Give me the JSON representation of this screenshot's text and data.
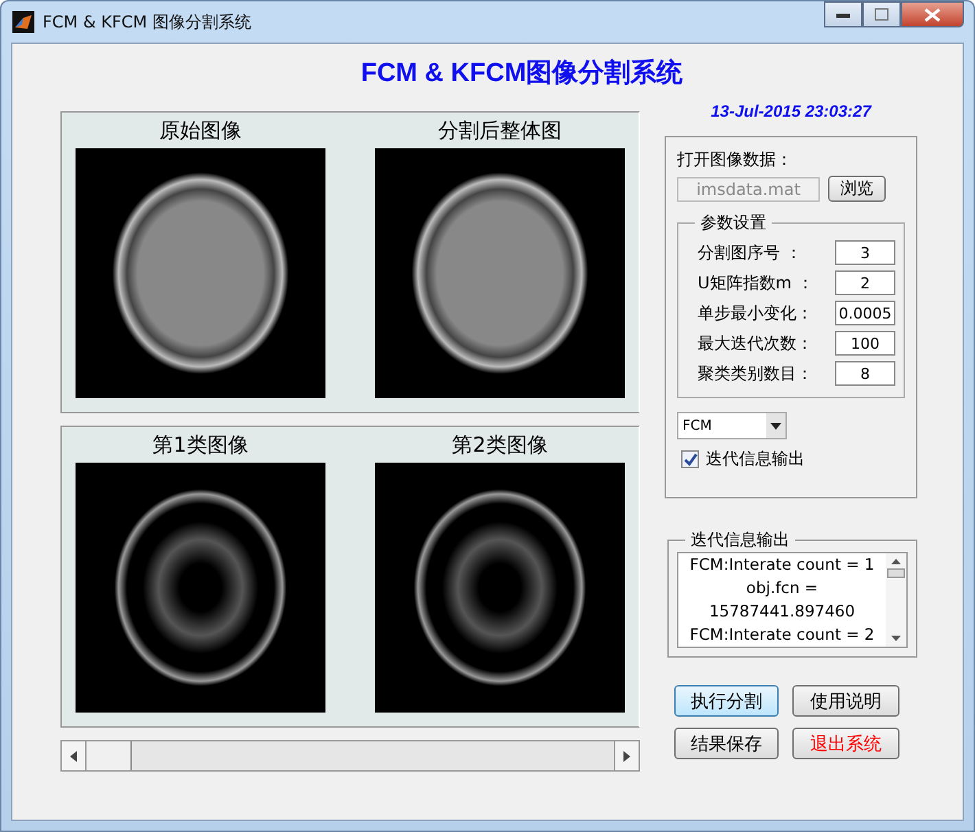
{
  "window": {
    "title": "FCM & KFCM 图像分割系统"
  },
  "heading": "FCM & KFCM图像分割系统",
  "datetime": "13-Jul-2015 23:03:27",
  "image_panels": [
    {
      "images": [
        {
          "title": "原始图像",
          "kind": "gray"
        },
        {
          "title": "分割后整体图",
          "kind": "gray"
        }
      ]
    },
    {
      "images": [
        {
          "title": "第1类图像",
          "kind": "binary"
        },
        {
          "title": "第2类图像",
          "kind": "binary"
        }
      ]
    }
  ],
  "controls": {
    "open_label": "打开图像数据：",
    "file_field": {
      "value": "imsdata.mat",
      "disabled": true
    },
    "browse_button": "浏览",
    "params_title": "参数设置",
    "params": [
      {
        "label": "分割图序号 ：",
        "value": "3"
      },
      {
        "label": "U矩阵指数m ：",
        "value": "2"
      },
      {
        "label": "单步最小变化：",
        "value": "0.0005"
      },
      {
        "label": "最大迭代次数：",
        "value": "100"
      },
      {
        "label": "聚类类别数目：",
        "value": "8"
      }
    ],
    "method_dropdown": {
      "value": "FCM"
    },
    "verbose_checkbox": {
      "label": "迭代信息输出",
      "checked": true
    }
  },
  "output": {
    "title": "迭代信息输出",
    "lines": [
      "FCM:Interate count = 1",
      "obj.fcn =",
      "15787441.897460",
      "FCM:Interate count = 2"
    ]
  },
  "buttons": [
    {
      "label": "执行分割",
      "focused": true
    },
    {
      "label": "使用说明",
      "focused": false
    },
    {
      "label": "结果保存",
      "focused": false
    },
    {
      "label": "退出系统",
      "focused": false,
      "color": "#ff0000"
    }
  ]
}
